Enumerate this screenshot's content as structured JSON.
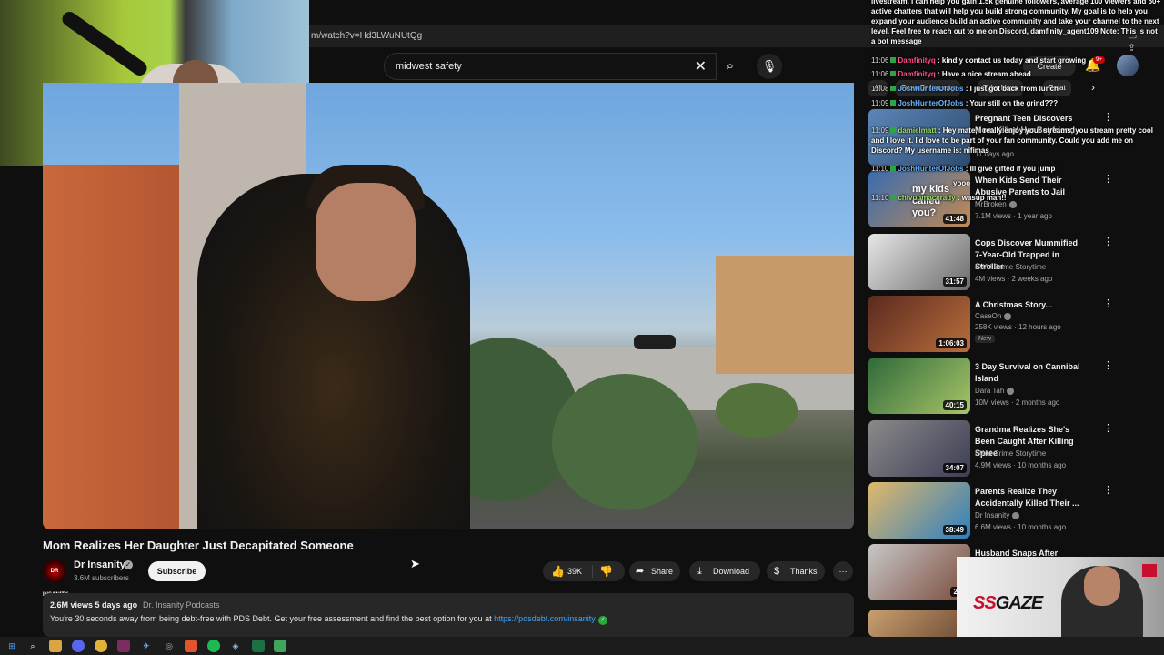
{
  "browser": {
    "url": "m/watch?v=Hd3LWuNUtQg"
  },
  "search": {
    "query": "midwest safety"
  },
  "header": {
    "create_label": "Create",
    "notif_count": "9+"
  },
  "video": {
    "title": "Mom Realizes Her Daughter Just Decapitated Someone",
    "channel": "Dr Insanity",
    "avatar_text": "DR INSANITY",
    "subscribers": "3.6M subscribers",
    "subscribe_label": "Subscribe",
    "likes": "39K",
    "share_label": "Share",
    "download_label": "Download",
    "thanks_label": "Thanks",
    "views": "2.6M views",
    "age": "5 days ago",
    "tag": "Dr. Insanity Podcasts",
    "description_text": "You're 30 seconds away from being debt-free with PDS Debt. Get your free assessment and find the best option for you at ",
    "description_link": "https://pdsdebt.com/insanity"
  },
  "chips": [
    {
      "label": "All"
    },
    {
      "label": "From Dr Insanity"
    },
    {
      "label": "Tyler Nuss"
    },
    {
      "label": "Relat"
    }
  ],
  "recommendations": [
    {
      "title": "Pregnant Teen Discovers Mom Killed Her Boyfriend",
      "channel": "",
      "stats": "11 days ago",
      "duration": ""
    },
    {
      "title": "When Kids Send Their Abusive Parents to Jail",
      "channel": "MrBroken",
      "stats": "7.1M views · 1 year ago",
      "duration": "41:48",
      "thumb_text": "my kids called you?"
    },
    {
      "title": "Cops Discover Mummified 7-Year-Old Trapped in Stroller",
      "channel": "EWU Crime Storytime",
      "stats": "4M views · 2 weeks ago",
      "duration": "31:57"
    },
    {
      "title": "A Christmas Story...",
      "channel": "CaseOh",
      "stats": "258K views · 12 hours ago",
      "duration": "1:06:03",
      "badge": "New"
    },
    {
      "title": "3 Day Survival on Cannibal Island",
      "channel": "Dara Tah",
      "stats": "10M views · 2 months ago",
      "duration": "40:15"
    },
    {
      "title": "Grandma Realizes She's Been Caught After Killing Spree",
      "channel": "EWU Crime Storytime",
      "stats": "4.9M views · 10 months ago",
      "duration": "34:07"
    },
    {
      "title": "Parents Realize They Accidentally Killed Their ...",
      "channel": "Dr Insanity",
      "stats": "6.6M views · 10 months ago",
      "duration": "38:49"
    },
    {
      "title": "Husband Snaps After Catching",
      "channel": "",
      "stats": "",
      "duration": "22:"
    }
  ],
  "chat": [
    {
      "time": "",
      "user": "",
      "text": "livestream. I can help you gain 1.5k genuine followers, average 100 viewers and 50+ active chatters that will help you build strong community. My goal is to help you expand your audience build an active community and take your channel to the next level. Feel free to reach out to me on Discord, damfinity_agent109 Note: This is not a bot message"
    },
    {
      "time": "11:06",
      "user": "Damfinityq",
      "text": ": kindly contact us today and start growing"
    },
    {
      "time": "11:06",
      "user": "Damfinityq",
      "text": ": Have a nice stream ahead"
    },
    {
      "time": "11:08",
      "user": "JoshHunterOfJobs",
      "text": ": I just got back from lunch"
    },
    {
      "time": "11:09",
      "user": "JoshHunterOfJobs",
      "text": ": Your still on the grind???"
    },
    {
      "time": "11:09",
      "user": "damielmatt",
      "text": ": Hey mate, I really enjoy your streams, you stream pretty cool and I love it. I'd love to be part of your fan community. Could you add me on Discord? My username is: nifimas"
    },
    {
      "time": "11:10",
      "user": "JoshHunterOfJobs",
      "text": ": Ill give gifted if you jump"
    },
    {
      "time": "11:10",
      "user": "",
      "text": "yooo"
    },
    {
      "time": "11:10",
      "user": "chivonmaccrady",
      "text": ": wasup man!!"
    }
  ],
  "overlay": {
    "brand_prefix": "SS",
    "brand_suffix": "GAZE"
  }
}
